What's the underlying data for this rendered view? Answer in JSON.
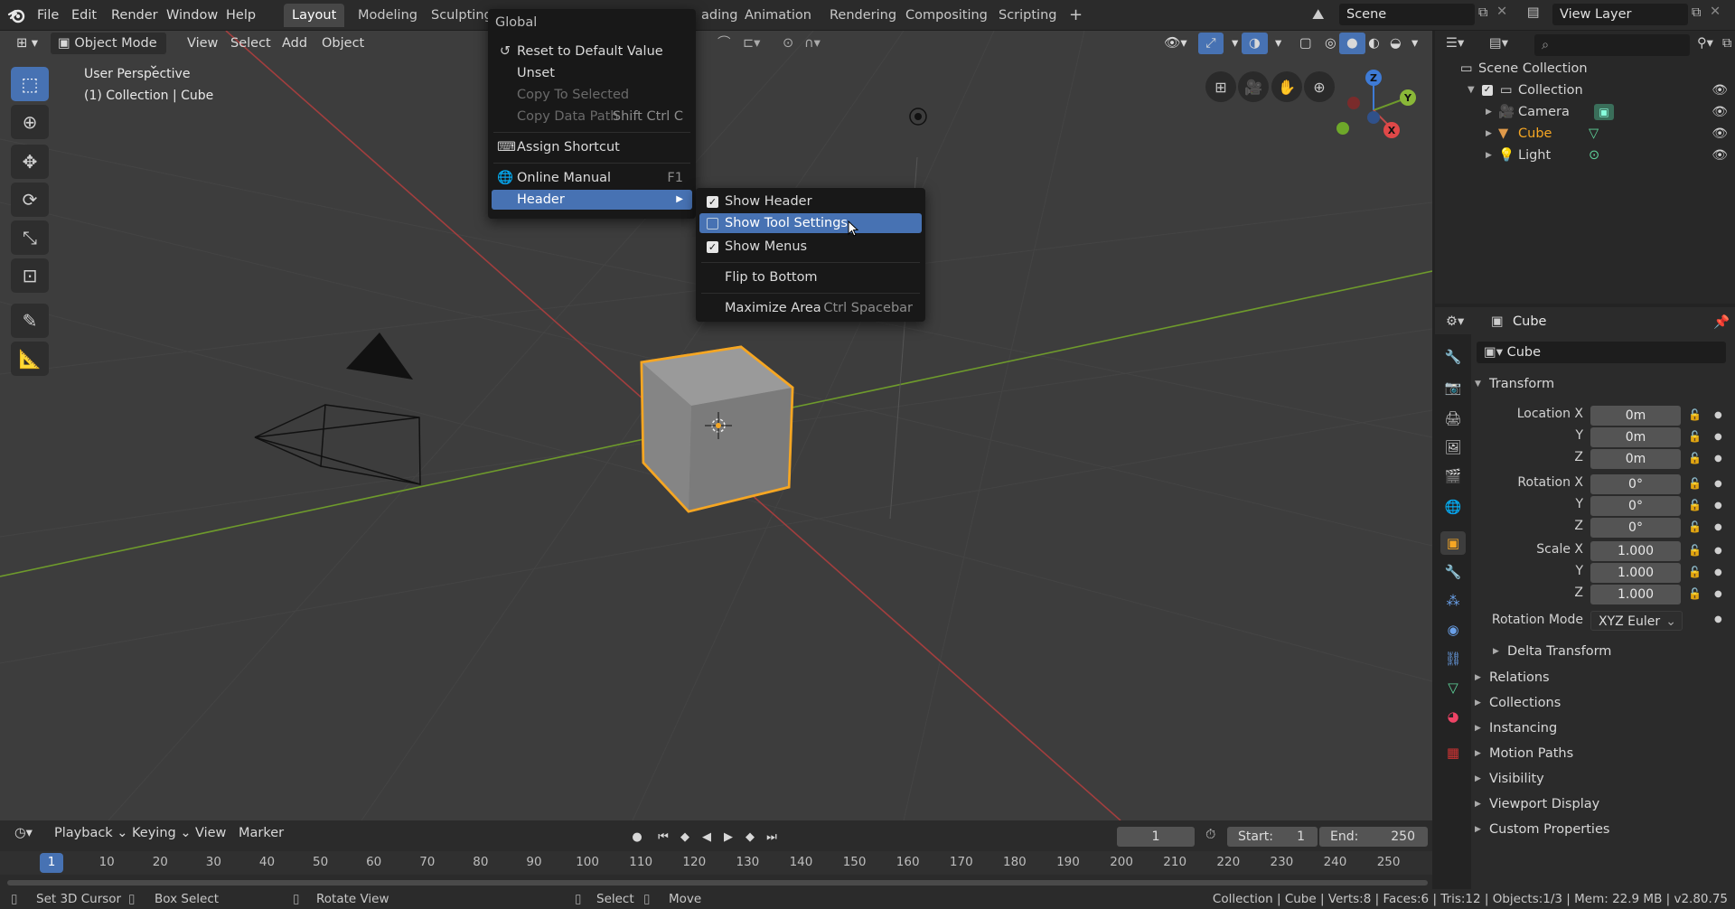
{
  "topbar": {
    "menus": [
      "File",
      "Edit",
      "Render",
      "Window",
      "Help"
    ],
    "tabs": [
      "Layout",
      "Modeling",
      "Sculpting",
      "Animation",
      "Rendering",
      "Compositing",
      "Scripting"
    ],
    "partial_tab_fragment": "ading",
    "scene_name": "Scene",
    "view_layer": "View Layer"
  },
  "viewport": {
    "mode": "Object Mode",
    "menus": [
      "View",
      "Select",
      "Add",
      "Object"
    ],
    "perspective": "User Perspective",
    "collection_info": "(1) Collection | Cube",
    "gizmo": {
      "x": "X",
      "y": "Y",
      "z": "Z"
    }
  },
  "context_menu": {
    "title": "Global",
    "items": [
      {
        "label": "Reset to Default Value",
        "shortcut": "",
        "disabled": false
      },
      {
        "label": "Unset",
        "shortcut": "",
        "disabled": false
      },
      {
        "label": "Copy To Selected",
        "shortcut": "",
        "disabled": true
      },
      {
        "label": "Copy Data Path",
        "shortcut": "Shift Ctrl C",
        "disabled": true
      },
      {
        "label": "Assign Shortcut",
        "shortcut": "",
        "disabled": false
      },
      {
        "label": "Online Manual",
        "shortcut": "F1",
        "disabled": false
      },
      {
        "label": "Header",
        "shortcut": "",
        "disabled": false
      }
    ]
  },
  "submenu": {
    "items": [
      {
        "label": "Show Header",
        "checked": true
      },
      {
        "label": "Show Tool Settings",
        "checked": false
      },
      {
        "label": "Show Menus",
        "checked": true
      },
      {
        "label": "Flip to Bottom",
        "shortcut": ""
      },
      {
        "label": "Maximize Area",
        "shortcut": "Ctrl Spacebar"
      }
    ]
  },
  "outliner": {
    "root": "Scene Collection",
    "collection": "Collection",
    "objects": [
      "Camera",
      "Cube",
      "Light"
    ]
  },
  "properties": {
    "header_object": "Cube",
    "object_name": "Cube",
    "transform_title": "Transform",
    "labels": {
      "location_x": "Location X",
      "y": "Y",
      "z": "Z",
      "rotation_x": "Rotation X",
      "scale_x": "Scale X",
      "rotation_mode": "Rotation Mode"
    },
    "location": [
      "0m",
      "0m",
      "0m"
    ],
    "rotation": [
      "0°",
      "0°",
      "0°"
    ],
    "scale": [
      "1.000",
      "1.000",
      "1.000"
    ],
    "rotation_mode": "XYZ Euler",
    "delta": "Delta Transform",
    "panels": [
      "Relations",
      "Collections",
      "Instancing",
      "Motion Paths",
      "Visibility",
      "Viewport Display",
      "Custom Properties"
    ]
  },
  "timeline": {
    "menus": [
      "Playback",
      "Keying",
      "View",
      "Marker"
    ],
    "current_frame": "1",
    "start_label": "Start:",
    "start": "1",
    "end_label": "End:",
    "end": "250",
    "ticks": [
      "1",
      "10",
      "20",
      "30",
      "40",
      "50",
      "60",
      "70",
      "80",
      "90",
      "100",
      "110",
      "120",
      "130",
      "140",
      "150",
      "160",
      "170",
      "180",
      "190",
      "200",
      "210",
      "220",
      "230",
      "240",
      "250"
    ]
  },
  "statusbar": {
    "hints": [
      "Set 3D Cursor",
      "Box Select",
      "Rotate View",
      "Select",
      "Move"
    ],
    "stats": "Collection | Cube | Verts:8 | Faces:6 | Tris:12 | Objects:1/3 | Mem: 22.9 MB | v2.80.75"
  },
  "colors": {
    "accent": "#4772b3",
    "selection_orange": "#f5a623",
    "x_axis": "#c14a4a",
    "y_axis": "#6e9a2c"
  }
}
